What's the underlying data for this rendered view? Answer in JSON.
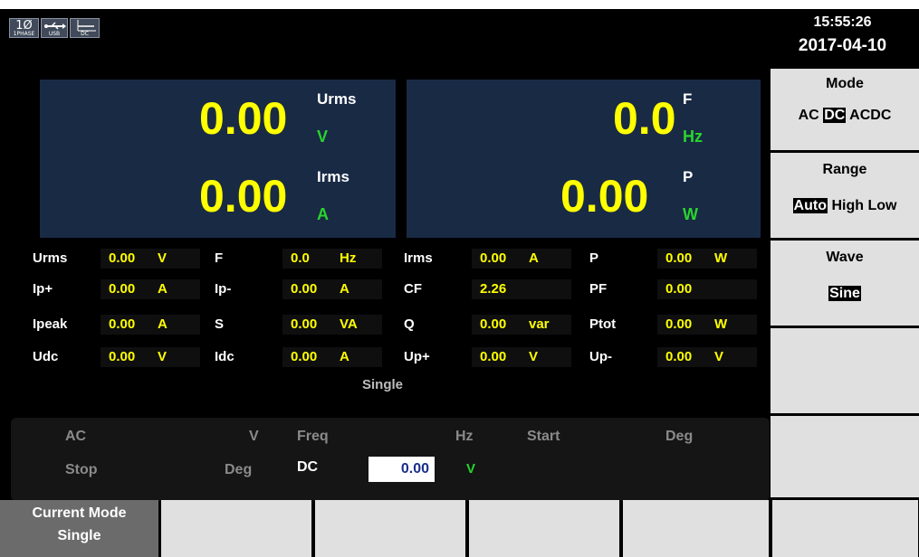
{
  "status": {
    "phase_icon": {
      "main": "1Ø",
      "sub": "1PHASE"
    },
    "usb_icon": {
      "sub": "USB"
    },
    "dc_icon": {
      "sub": "DC"
    },
    "time": "15:55:26",
    "date": "2017-04-10"
  },
  "display": {
    "left": {
      "urms": {
        "value": "0.00",
        "label": "Urms",
        "unit": "V"
      },
      "irms": {
        "value": "0.00",
        "label": "Irms",
        "unit": "A"
      }
    },
    "right": {
      "f": {
        "value": "0.0",
        "label": "F",
        "unit": "Hz"
      },
      "p": {
        "value": "0.00",
        "label": "P",
        "unit": "W"
      }
    }
  },
  "measurements": {
    "rows": [
      [
        {
          "label": "Urms",
          "value": "0.00",
          "unit": "V"
        },
        {
          "label": "F",
          "value": "0.0",
          "unit": "Hz"
        },
        {
          "label": "Irms",
          "value": "0.00",
          "unit": "A"
        },
        {
          "label": "P",
          "value": "0.00",
          "unit": "W"
        }
      ],
      [
        {
          "label": "Ip+",
          "value": "0.00",
          "unit": "A"
        },
        {
          "label": "Ip-",
          "value": "0.00",
          "unit": "A"
        },
        {
          "label": "CF",
          "value": "2.26",
          "unit": ""
        },
        {
          "label": "PF",
          "value": "0.00",
          "unit": ""
        }
      ],
      [
        {
          "label": "Ipeak",
          "value": "0.00",
          "unit": "A"
        },
        {
          "label": "S",
          "value": "0.00",
          "unit": "VA"
        },
        {
          "label": "Q",
          "value": "0.00",
          "unit": "var"
        },
        {
          "label": "Ptot",
          "value": "0.00",
          "unit": "W"
        }
      ],
      [
        {
          "label": "Udc",
          "value": "0.00",
          "unit": "V"
        },
        {
          "label": "Idc",
          "value": "0.00",
          "unit": "A"
        },
        {
          "label": "Up+",
          "value": "0.00",
          "unit": "V"
        },
        {
          "label": "Up-",
          "value": "0.00",
          "unit": "V"
        }
      ]
    ],
    "mode_caption": "Single"
  },
  "params": {
    "ac_label": "AC",
    "v_unit": "V",
    "freq_label": "Freq",
    "hz_unit": "Hz",
    "start_label": "Start",
    "deg_unit_1": "Deg",
    "stop_label": "Stop",
    "deg_unit_2": "Deg",
    "dc_label": "DC",
    "dc_value": "0.00",
    "dc_unit": "V"
  },
  "side_menu": {
    "mode": {
      "title": "Mode",
      "options": [
        "AC",
        "DC",
        "ACDC"
      ],
      "selected": "DC"
    },
    "range": {
      "title": "Range",
      "options": [
        "Auto",
        "High",
        "Low"
      ],
      "selected": "Auto"
    },
    "wave": {
      "title": "Wave",
      "options": [
        "Sine"
      ],
      "selected": "Sine"
    }
  },
  "bottom_menu": {
    "current_mode": {
      "line1": "Current Mode",
      "line2": "Single"
    }
  },
  "colors": {
    "value_yellow": "#ffff00",
    "unit_green": "#29d52c",
    "panel_blue": "#192a45",
    "button_gray": "#e0e0e0"
  }
}
